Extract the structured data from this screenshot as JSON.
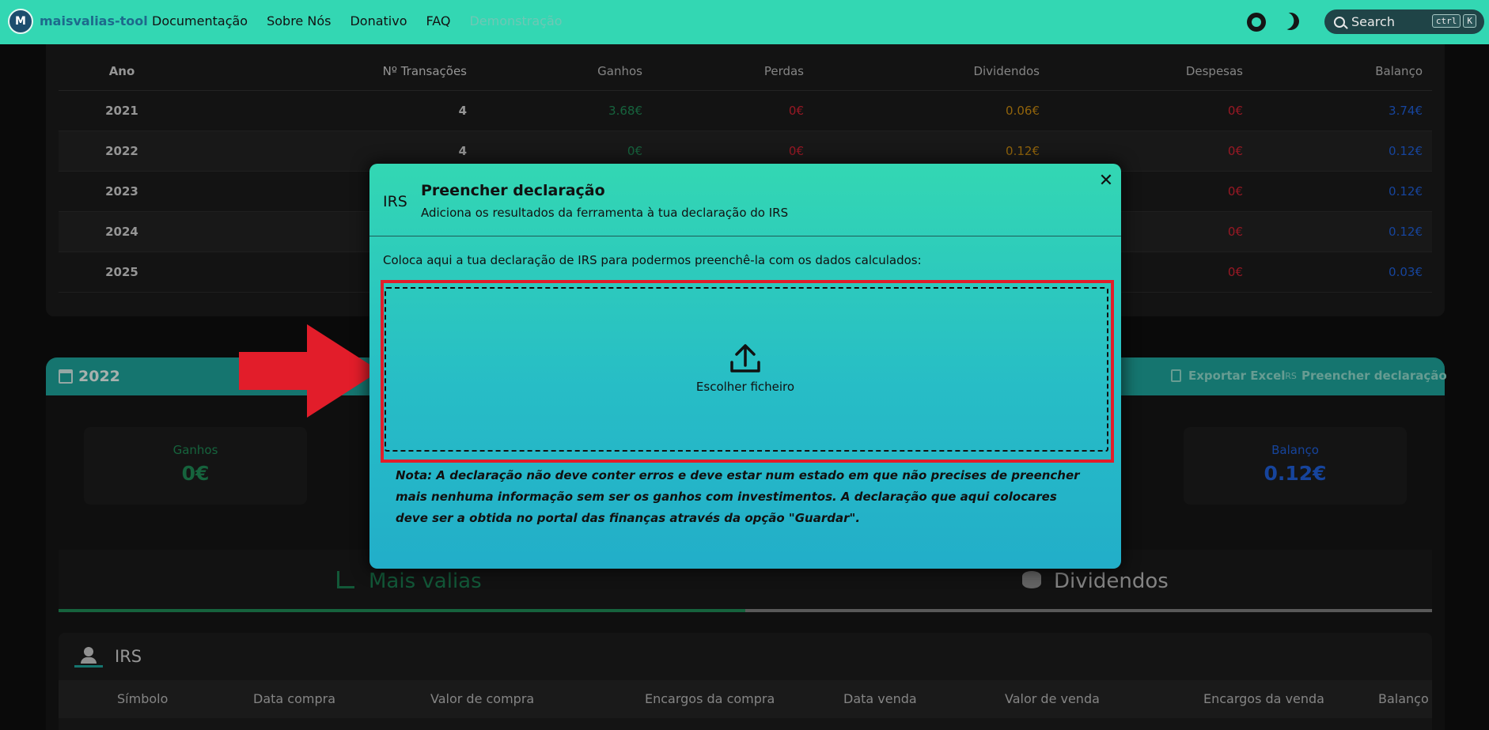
{
  "navbar": {
    "brand": "maisvalias-tool",
    "links": [
      "Documentação",
      "Sobre Nós",
      "Donativo",
      "FAQ",
      "Demonstração"
    ],
    "search_label": "Search",
    "kbd": [
      "ctrl",
      "K"
    ]
  },
  "summary": {
    "headers": [
      "Ano",
      "Nº Transações",
      "Ganhos",
      "Perdas",
      "Dividendos",
      "Despesas",
      "Balanço"
    ],
    "rows": [
      {
        "ano": "2021",
        "transacoes": "4",
        "ganhos": "3.68€",
        "perdas": "0€",
        "dividendos": "0.06€",
        "despesas": "0€",
        "balanco": "3.74€"
      },
      {
        "ano": "2022",
        "transacoes": "4",
        "ganhos": "0€",
        "perdas": "0€",
        "dividendos": "0.12€",
        "despesas": "0€",
        "balanco": "0.12€"
      },
      {
        "ano": "2023",
        "transacoes": "",
        "ganhos": "",
        "perdas": "",
        "dividendos": "",
        "despesas": "0€",
        "balanco": "0.12€"
      },
      {
        "ano": "2024",
        "transacoes": "",
        "ganhos": "",
        "perdas": "",
        "dividendos": "",
        "despesas": "0€",
        "balanco": "0.12€"
      },
      {
        "ano": "2025",
        "transacoes": "",
        "ganhos": "",
        "perdas": "",
        "dividendos": "",
        "despesas": "0€",
        "balanco": "0.03€"
      }
    ]
  },
  "year_section": {
    "year": "2022",
    "export_label": "Exportar Excel",
    "irs_small": "IRS",
    "fill_label": "Preencher declaração",
    "stats": [
      {
        "label": "Ganhos",
        "value": "0€"
      },
      {
        "label": "Balanço",
        "value": "0.12€"
      }
    ],
    "tabs": [
      "Mais valias",
      "Dividendos"
    ],
    "irs_title": "IRS",
    "columns": [
      "Símbolo",
      "Data compra",
      "Valor de compra",
      "Encargos da compra",
      "Data venda",
      "Valor de venda",
      "Encargos da venda",
      "Balanço"
    ]
  },
  "modal": {
    "badge": "IRS",
    "title": "Preencher declaração",
    "subtitle": "Adiciona os resultados da ferramenta à tua declaração do IRS",
    "close": "✕",
    "instruction": "Coloca aqui a tua declaração de IRS para podermos preenchê-la com os dados calculados:",
    "upload_label": "Escolher ficheiro",
    "note": "Nota: A declaração não deve conter erros e deve estar num estado em que não precises de preencher mais nenhuma informação sem ser os ganhos com investimentos. A declaração que aqui colocares deve ser a obtida no portal das finanças através da opção \"Guardar\"."
  },
  "colors": {
    "navbar": "#33d7b3",
    "annotation_red": "#e21d2a",
    "gain_green": "#1f8a55",
    "loss_red": "#d32232",
    "dividend_orange": "#c88a10",
    "balance_blue": "#1f5fd9"
  }
}
